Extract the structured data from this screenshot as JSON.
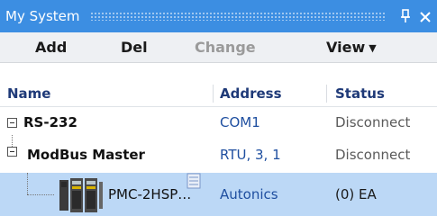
{
  "panel": {
    "title": "My System",
    "pin_glyph": "ᅟᅟ2",
    "close_glyph": "✕"
  },
  "toolbar": {
    "add_label": "Add",
    "del_label": "Del",
    "change_label": "Change",
    "view_label": "View"
  },
  "columns": {
    "name": "Name",
    "address": "Address",
    "status": "Status"
  },
  "tree": [
    {
      "name": "RS-232",
      "address": "COM1",
      "status": "Disconnect",
      "level": 0,
      "expanded": true
    },
    {
      "name": "ModBus Master",
      "address": "RTU, 3, 1",
      "status": "Disconnect",
      "level": 1,
      "expanded": true
    },
    {
      "name": "PMC-2HSP…",
      "address": "Autonics",
      "status": "(0) EA",
      "level": 2,
      "selected": true,
      "icon": "device-icon"
    }
  ],
  "colors": {
    "titlebar": "#3c8ee2",
    "header_text": "#1f3a78",
    "address_text": "#1f4fa0",
    "selection": "#bcd8f6"
  }
}
